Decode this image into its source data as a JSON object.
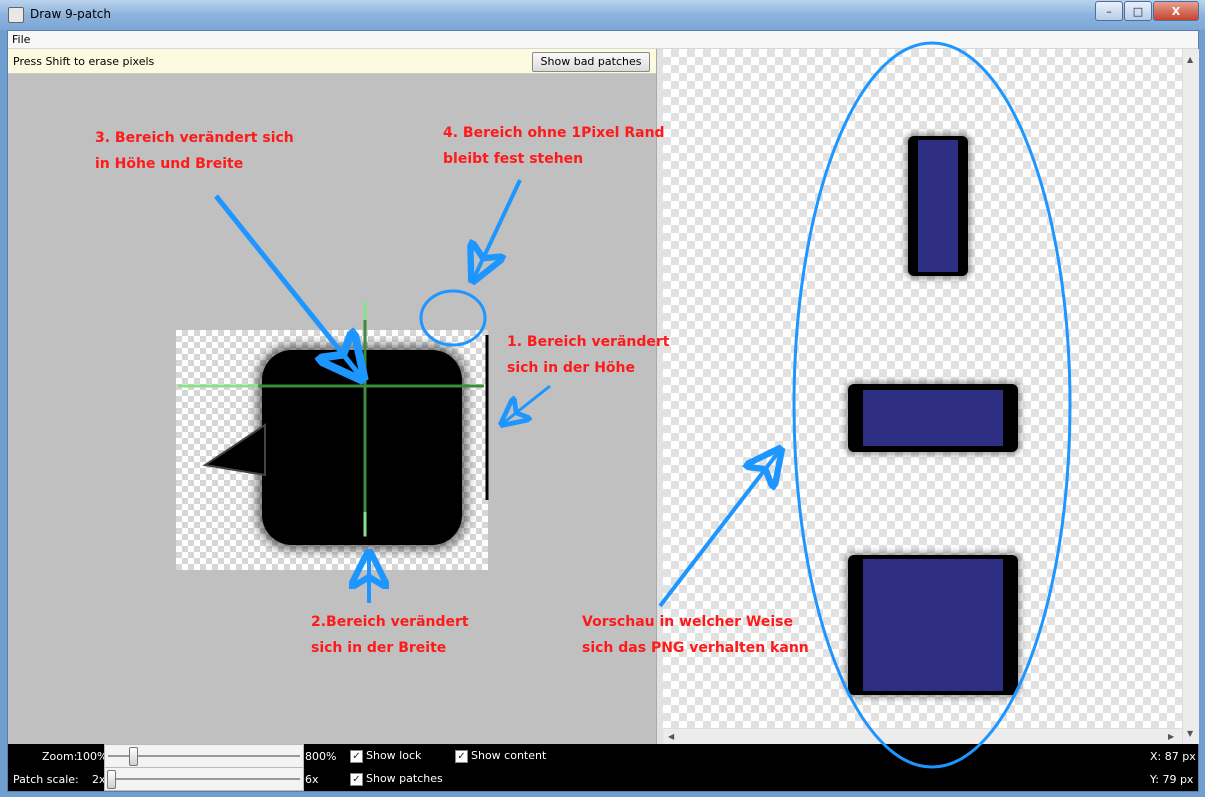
{
  "window": {
    "title": "Draw 9-patch",
    "buttons": [
      "–",
      "□",
      "X"
    ]
  },
  "menu": {
    "file": "File"
  },
  "hint": {
    "text": "Press Shift to erase pixels",
    "button": "Show bad patches"
  },
  "controls": {
    "zoom_label": "Zoom:",
    "zoom_min": "100%",
    "zoom_max": "800%",
    "patch_label": "Patch scale:",
    "patch_min": "2x",
    "patch_max": "6x",
    "show_lock": "Show lock",
    "show_patches": "Show patches",
    "show_content": "Show content",
    "x_readout": "X: 87 px",
    "y_readout": "Y: 79 px"
  },
  "annotations": {
    "a3_l1": "3. Bereich verändert sich",
    "a3_l2": "in Höhe und Breite",
    "a4_l1": "4. Bereich ohne 1Pixel Rand",
    "a4_l2": "bleibt fest stehen",
    "a1_l1": "1. Bereich verändert",
    "a1_l2": "sich in der Höhe",
    "a2_l1": "2.Bereich verändert",
    "a2_l2": "sich in der Breite",
    "av_l1": "Vorschau in welcher Weise",
    "av_l2": "sich das PNG verhalten kann"
  },
  "colors": {
    "annotation_text": "#ff1a1a",
    "annotation_shape": "#1e96ff",
    "patch_guide": "#3c8c3c",
    "preview_fill": "#2e2e82"
  }
}
